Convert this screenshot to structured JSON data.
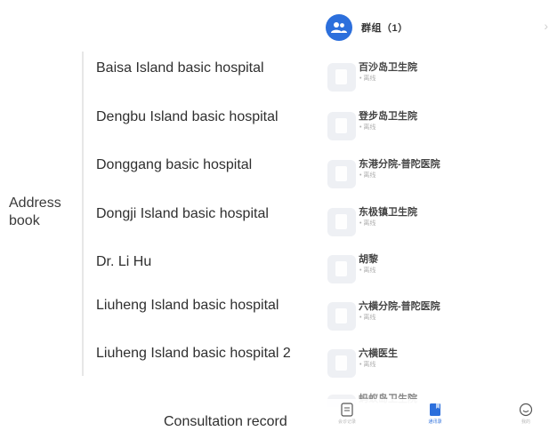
{
  "annotations": {
    "address_book": "Address book",
    "consultation_record": "Consultation record",
    "contacts_en": [
      "Baisa Island basic hospital",
      "Dengbu Island basic hospital",
      "Donggang basic hospital",
      "Dongji Island basic hospital",
      "Dr. Li Hu",
      "Liuheng Island basic hospital",
      "Liuheng Island basic hospital 2"
    ]
  },
  "app": {
    "group": {
      "name": "群组（1）",
      "icon": "group-icon"
    },
    "contacts": [
      {
        "name": "百沙岛卫生院",
        "sub": "• 离线"
      },
      {
        "name": "登步岛卫生院",
        "sub": "• 离线"
      },
      {
        "name": "东港分院-普陀医院",
        "sub": "• 离线"
      },
      {
        "name": "东极镇卫生院",
        "sub": "• 离线"
      },
      {
        "name": "胡黎",
        "sub": "• 离线"
      },
      {
        "name": "六横分院-普陀医院",
        "sub": "• 离线"
      },
      {
        "name": "六横医生",
        "sub": "• 离线"
      }
    ],
    "partial_contact": "蚂蚁岛卫生院",
    "nav": [
      {
        "label": "会诊记录",
        "icon": "document-icon",
        "active": false
      },
      {
        "label": "通讯录",
        "icon": "address-book-icon",
        "active": true
      },
      {
        "label": "我的",
        "icon": "profile-icon",
        "active": false
      }
    ],
    "colors": {
      "accent": "#2c6fdc",
      "avatar_bg": "#eef0f4"
    }
  }
}
